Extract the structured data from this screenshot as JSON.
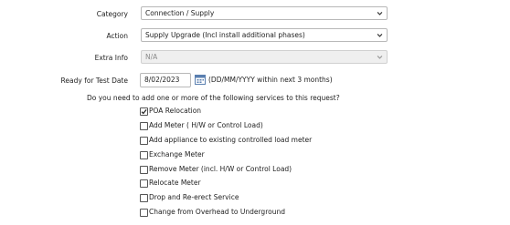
{
  "form": {
    "category": {
      "label": "Category",
      "value": "Connection / Supply"
    },
    "action": {
      "label": "Action",
      "value": "Supply Upgrade (Incl install additional phases)"
    },
    "extra_info": {
      "label": "Extra Info",
      "value": "N/A",
      "disabled": true
    },
    "ready_for_test": {
      "label": "Ready for Test Date",
      "value": "8/02/2023",
      "hint": "(DD/MM/YYYY within next 3 months)"
    },
    "services_question": "Do you need to add one or more of the following services to this request?",
    "services": [
      {
        "label": "POA Relocation",
        "checked": true
      },
      {
        "label": "Add Meter ( H/W or Control Load)",
        "checked": false
      },
      {
        "label": "Add appliance to existing controlled load meter",
        "checked": false
      },
      {
        "label": "Exchange Meter",
        "checked": false
      },
      {
        "label": "Remove Meter (incl. H/W or Control Load)",
        "checked": false
      },
      {
        "label": "Relocate Meter",
        "checked": false
      },
      {
        "label": "Drop and Re-erect Service",
        "checked": false
      },
      {
        "label": "Change from Overhead to Underground",
        "checked": false
      }
    ]
  },
  "icons": {
    "dropdown": "chevron-down-icon",
    "calendar": "calendar-icon",
    "check": "checkmark-icon"
  }
}
